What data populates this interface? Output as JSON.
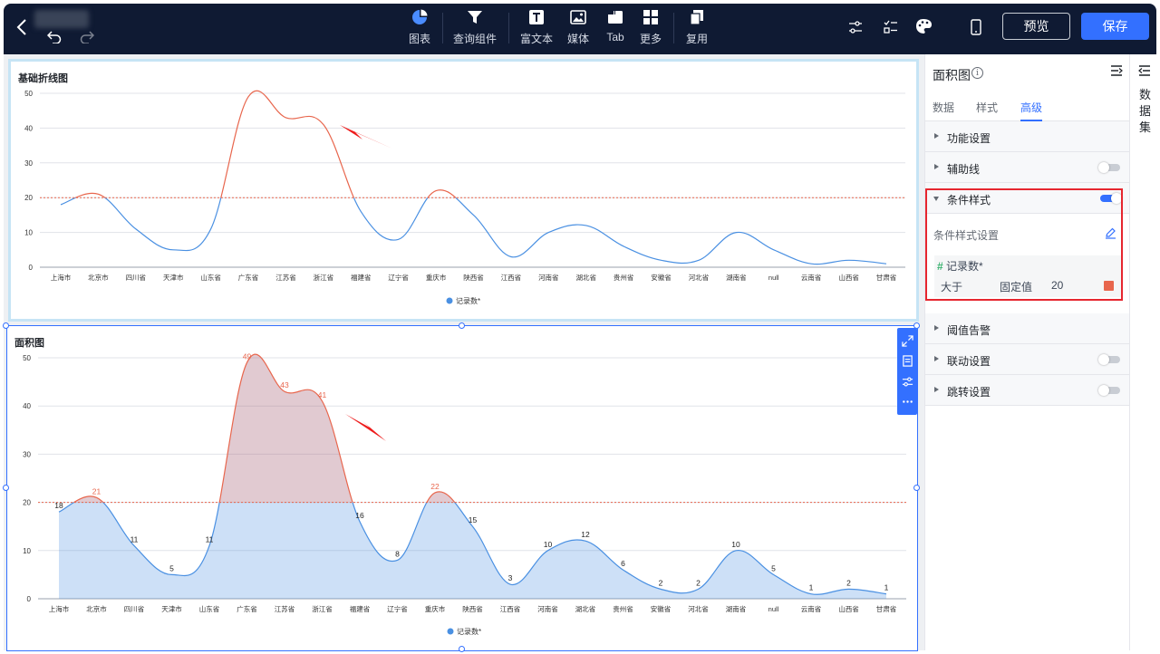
{
  "toolbar": {
    "items": [
      {
        "label": "图表",
        "icon": "pie-chart-icon"
      },
      {
        "label": "查询组件",
        "icon": "filter-icon"
      },
      {
        "label": "富文本",
        "icon": "text-icon"
      },
      {
        "label": "媒体",
        "icon": "image-icon"
      },
      {
        "label": "Tab",
        "icon": "tab-icon"
      },
      {
        "label": "更多",
        "icon": "grid-icon"
      },
      {
        "label": "复用",
        "icon": "copy-icon"
      }
    ],
    "preview_label": "预览",
    "save_label": "保存"
  },
  "colors": {
    "topbar": "#0f1a33",
    "accent": "#3370ff",
    "line_default": "#4a90e2",
    "line_condition": "#e8664d",
    "threshold": "#e8664d"
  },
  "panel": {
    "title": "面积图",
    "tabs": [
      {
        "label": "数据",
        "active": false
      },
      {
        "label": "样式",
        "active": false
      },
      {
        "label": "高级",
        "active": true
      }
    ],
    "sections": {
      "func": {
        "label": "功能设置"
      },
      "aux": {
        "label": "辅助线",
        "toggle": false
      },
      "cond": {
        "label": "条件样式",
        "toggle": true,
        "expanded": true
      },
      "threshold": {
        "label": "阈值告警"
      },
      "link": {
        "label": "联动设置",
        "toggle": false
      },
      "jump": {
        "label": "跳转设置",
        "toggle": false
      }
    },
    "condition": {
      "setting_label": "条件样式设置",
      "field_hash": "#",
      "field_name": "记录数*",
      "operator": "大于",
      "value_type": "固定值",
      "value": "20",
      "color": "#e8664d"
    }
  },
  "dataset": {
    "label": "数据集"
  },
  "chart_data": [
    {
      "type": "line",
      "title": "基础折线图",
      "categories": [
        "上海市",
        "北京市",
        "四川省",
        "天津市",
        "山东省",
        "广东省",
        "江苏省",
        "浙江省",
        "福建省",
        "辽宁省",
        "重庆市",
        "陕西省",
        "江西省",
        "河南省",
        "湖北省",
        "贵州省",
        "安徽省",
        "河北省",
        "湖南省",
        "null",
        "云南省",
        "山西省",
        "甘肃省"
      ],
      "series": [
        {
          "name": "记录数*",
          "values": [
            18,
            21,
            11,
            5,
            11,
            49,
            43,
            41,
            16,
            8,
            22,
            15,
            3,
            10,
            12,
            6,
            2,
            2,
            10,
            5,
            1,
            2,
            1
          ]
        }
      ],
      "ylim": [
        0,
        50
      ],
      "yticks": [
        "0",
        "10",
        "20",
        "30",
        "40",
        "50"
      ],
      "threshold": 20,
      "condition_color_above": "#e8664d",
      "legend": "bottom-center",
      "grid": true,
      "data_labels": false
    },
    {
      "type": "area",
      "title": "面积图",
      "categories": [
        "上海市",
        "北京市",
        "四川省",
        "天津市",
        "山东省",
        "广东省",
        "江苏省",
        "浙江省",
        "福建省",
        "辽宁省",
        "重庆市",
        "陕西省",
        "江西省",
        "河南省",
        "湖北省",
        "贵州省",
        "安徽省",
        "河北省",
        "湖南省",
        "null",
        "云南省",
        "山西省",
        "甘肃省"
      ],
      "series": [
        {
          "name": "记录数*",
          "values": [
            18,
            21,
            11,
            5,
            11,
            49,
            43,
            41,
            16,
            8,
            22,
            15,
            3,
            10,
            12,
            6,
            2,
            2,
            10,
            5,
            1,
            2,
            1
          ]
        }
      ],
      "labels": [
        "18",
        "21",
        "11",
        "5",
        "11",
        "49",
        "43",
        "41",
        "16",
        "8",
        "22",
        "15",
        "3",
        "10",
        "12",
        "6",
        "2",
        "2",
        "10",
        "5",
        "1",
        "2",
        "1"
      ],
      "ylim": [
        0,
        50
      ],
      "yticks": [
        "0",
        "10",
        "20",
        "30",
        "40",
        "50"
      ],
      "threshold": 20,
      "condition_color_above": "#e8664d",
      "legend": "bottom-center",
      "grid": true,
      "data_labels": true
    }
  ]
}
